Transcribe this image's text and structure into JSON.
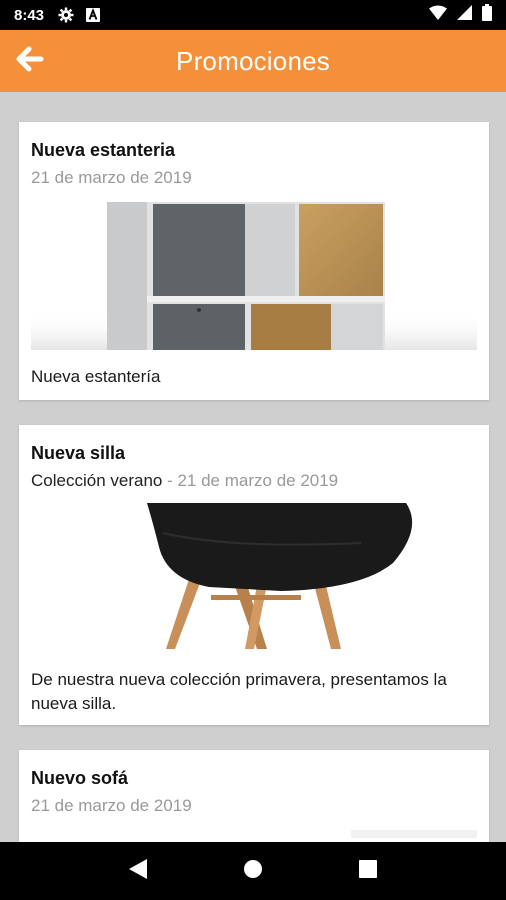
{
  "status_bar": {
    "time": "8:43",
    "icons": [
      "gear-icon",
      "a-letter-icon",
      "wifi-icon",
      "signal-icon",
      "battery-icon"
    ]
  },
  "app_bar": {
    "title": "Promociones",
    "back_icon": "arrow-left-icon",
    "color": "#f4903a"
  },
  "promotions": [
    {
      "title": "Nueva estanteria",
      "category": "",
      "date": "21 de marzo de 2019",
      "image": "shelf-image",
      "description": "Nueva estantería"
    },
    {
      "title": "Nueva silla",
      "category": "Colección verano",
      "separator": " - ",
      "date": "21 de marzo de 2019",
      "image": "chair-image",
      "description": "De nuestra nueva colección primavera, presentamos la nueva silla."
    },
    {
      "title": "Nuevo sofá",
      "category": "",
      "date": "21 de marzo de 2019",
      "image": "sofa-image",
      "description": ""
    }
  ],
  "nav_bar": {
    "icons": [
      "back-triangle-icon",
      "home-circle-icon",
      "recents-square-icon"
    ]
  }
}
